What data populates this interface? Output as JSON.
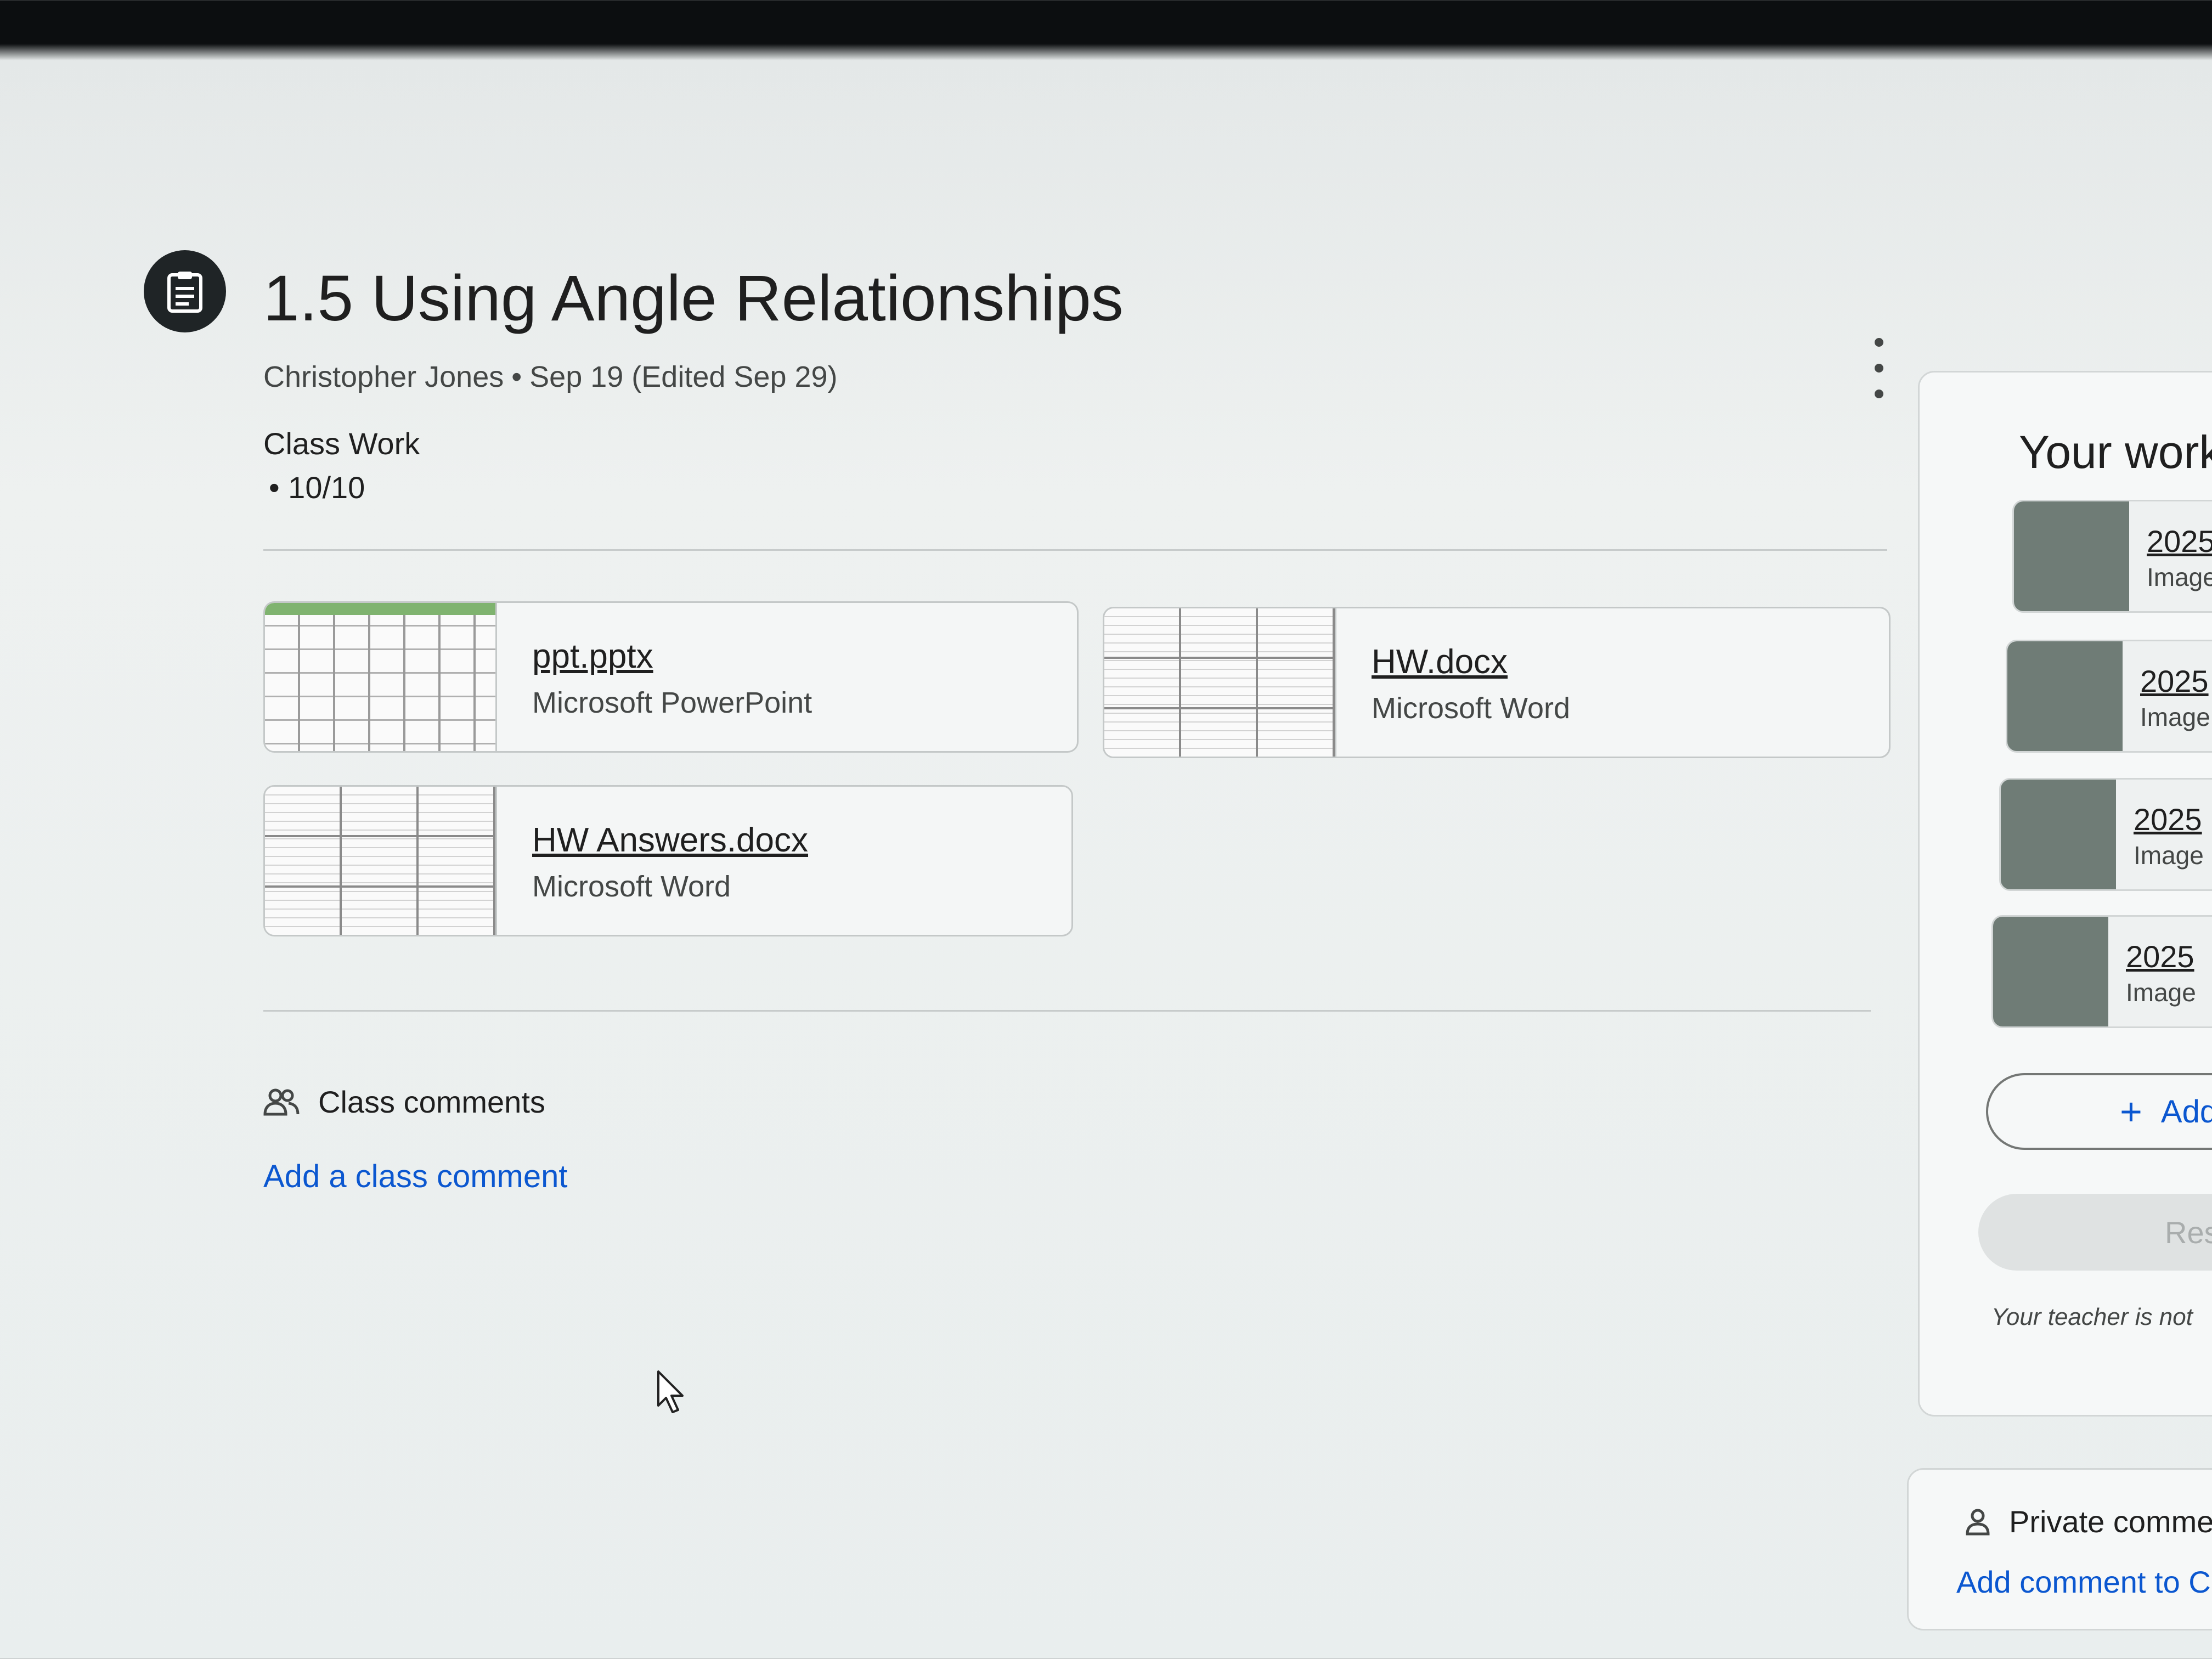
{
  "assignment": {
    "icon": "assignment-icon",
    "title": "1.5 Using Angle Relationships",
    "author": "Christopher Jones",
    "date": "Sep 19 (Edited Sep 29)",
    "category": "Class Work",
    "points": "10/10",
    "menu_icon": "more-vert-icon"
  },
  "attachments": [
    {
      "name": "ppt.pptx",
      "type": "Microsoft PowerPoint"
    },
    {
      "name": "HW.docx",
      "type": "Microsoft Word"
    },
    {
      "name": "HW Answers.docx",
      "type": "Microsoft Word"
    }
  ],
  "class_comments": {
    "icon": "people-icon",
    "heading": "Class comments",
    "add_label": "Add a class comment"
  },
  "your_work": {
    "title": "Your work",
    "items": [
      {
        "name": "2025",
        "type": "Image"
      },
      {
        "name": "2025",
        "type": "Image"
      },
      {
        "name": "2025",
        "type": "Image"
      },
      {
        "name": "2025",
        "type": "Image"
      }
    ],
    "add_label": "Add",
    "resubmit_label": "Res",
    "notice": "Your teacher is not"
  },
  "private_comments": {
    "icon": "person-icon",
    "heading": "Private comme",
    "add_label": "Add comment to Ch"
  }
}
